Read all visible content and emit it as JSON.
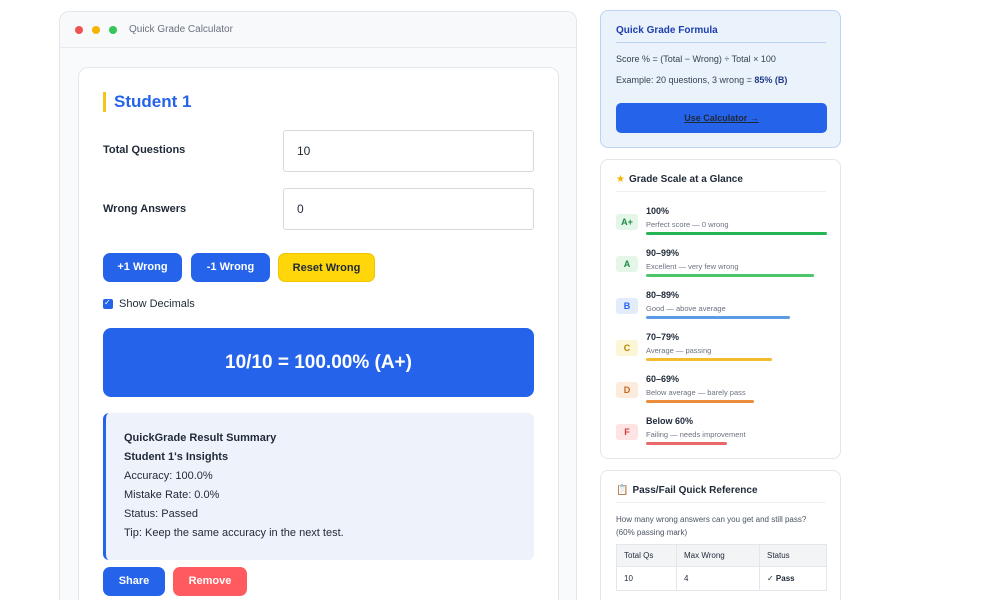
{
  "window": {
    "title": "Quick Grade Calculator"
  },
  "student": {
    "heading": "Student 1",
    "total_label": "Total Questions",
    "total_value": "10",
    "wrong_label": "Wrong Answers",
    "wrong_value": "0",
    "buttons": {
      "plus_wrong": "+1 Wrong",
      "minus_wrong": "-1 Wrong",
      "reset_wrong": "Reset Wrong"
    },
    "show_decimals_label": "Show Decimals",
    "show_decimals_checked": true,
    "result": "10/10 = 100.00% (A+)",
    "summary": {
      "title": "QuickGrade Result Summary",
      "insights_title": "Student 1's Insights",
      "accuracy": "Accuracy: 100.0%",
      "mistake_rate": "Mistake Rate: 0.0%",
      "status": "Status: Passed",
      "tip": "Tip: Keep the same accuracy in the next test."
    },
    "share_label": "Share",
    "remove_label": "Remove"
  },
  "formula": {
    "title": "Quick Grade Formula",
    "formula_text": "Score % = (Total − Wrong) ÷ Total × 100",
    "example_prefix": "Example: 20 questions, 3 wrong = ",
    "example_result": "85% (B)",
    "cta_label": "Use Calculator →"
  },
  "grade_scale": {
    "title": "Grade Scale at a Glance",
    "title_icon": "star-icon",
    "rows": [
      {
        "badge": "A+",
        "range": "100%",
        "desc": "Perfect score — 0 wrong",
        "color": "#22b455",
        "badge_bg": "#e3f6e8",
        "badge_fg": "#1e8a45"
      },
      {
        "badge": "A",
        "range": "90–99%",
        "desc": "Excellent — very few wrong",
        "color": "#4cc56b",
        "badge_bg": "#e3f6e8",
        "badge_fg": "#1e8a45"
      },
      {
        "badge": "B",
        "range": "80–89%",
        "desc": "Good — above average",
        "color": "#5b9be6",
        "badge_bg": "#e2ecfb",
        "badge_fg": "#2563eb"
      },
      {
        "badge": "C",
        "range": "70–79%",
        "desc": "Average — passing",
        "color": "#f2bc2c",
        "badge_bg": "#fdf6d6",
        "badge_fg": "#b58300"
      },
      {
        "badge": "D",
        "range": "60–69%",
        "desc": "Below average — barely pass",
        "color": "#ec8d3c",
        "badge_bg": "#fdebdb",
        "badge_fg": "#c4661b"
      },
      {
        "badge": "F",
        "range": "Below 60%",
        "desc": "Failing — needs improvement",
        "color": "#e9696a",
        "badge_bg": "#fde3e3",
        "badge_fg": "#d33a3a"
      }
    ]
  },
  "pass_fail": {
    "title": "Pass/Fail Quick Reference",
    "title_icon": "clipboard-icon",
    "description": "How many wrong answers can you get and still pass? (60% passing mark)",
    "headers": [
      "Total Qs",
      "Max Wrong",
      "Status"
    ],
    "rows": [
      [
        "10",
        "4",
        "✓ Pass"
      ]
    ]
  }
}
